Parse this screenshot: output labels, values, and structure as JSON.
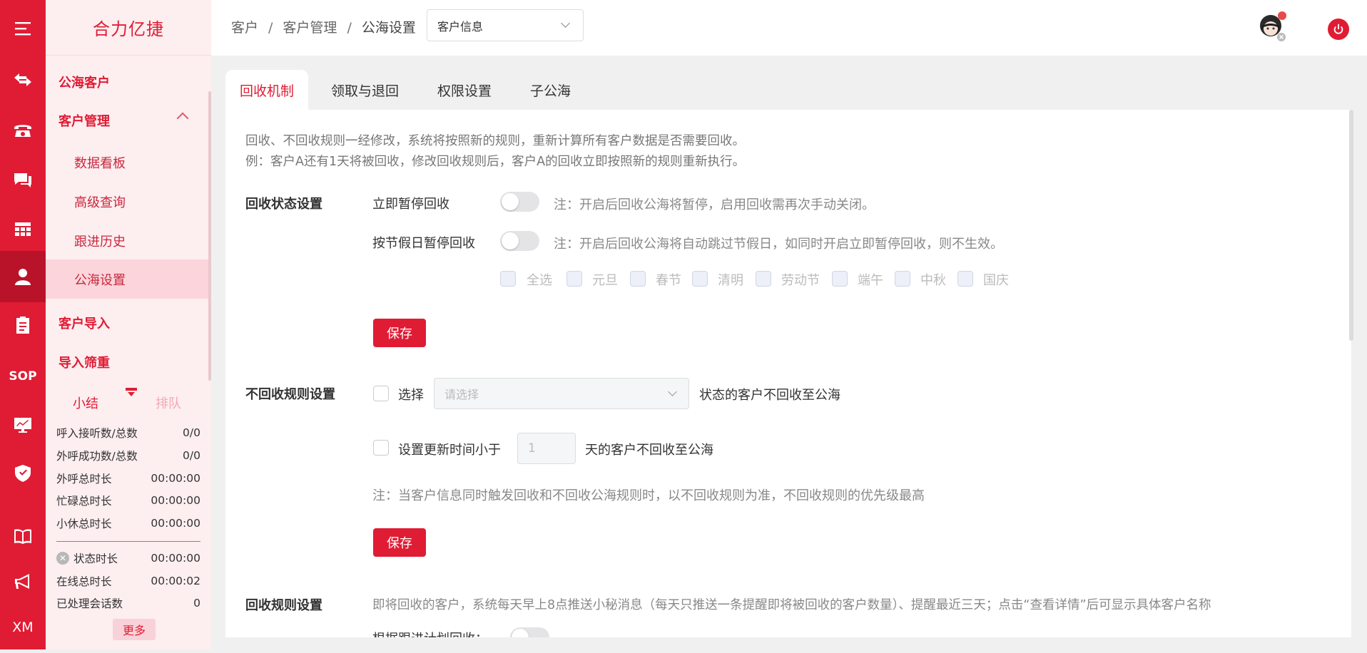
{
  "app": {
    "brand": "合力亿捷"
  },
  "rail": {
    "sop_label": "SOP",
    "xm_label": "XM"
  },
  "sidebar": {
    "group_public": "公海客户",
    "group_manage": "客户管理",
    "sub_dashboard": "数据看板",
    "sub_query": "高级查询",
    "sub_history": "跟进历史",
    "sub_settings": "公海设置",
    "group_import": "客户导入",
    "group_dedupe": "导入筛重"
  },
  "stats": {
    "tab_summary": "小结",
    "tab_queue": "排队",
    "rows": [
      {
        "label": "呼入接听数/总数",
        "value": "0/0"
      },
      {
        "label": "外呼成功数/总数",
        "value": "0/0"
      },
      {
        "label": "外呼总时长",
        "value": "00:00:00"
      },
      {
        "label": "忙碌总时长",
        "value": "00:00:00"
      },
      {
        "label": "小休总时长",
        "value": "00:00:00"
      }
    ],
    "state_label": "状态时长",
    "state_value": "00:00:00",
    "online_label": "在线总时长",
    "online_value": "00:00:02",
    "handled_label": "已处理会话数",
    "handled_value": "0",
    "more": "更多"
  },
  "header": {
    "crumb1": "客户",
    "crumb2": "客户管理",
    "crumb3": "公海设置",
    "sep": "/",
    "select_value": "客户信息"
  },
  "tabs": {
    "recycle": "回收机制",
    "claim": "领取与退回",
    "permission": "权限设置",
    "sub_sea": "子公海"
  },
  "intro": {
    "line1": "回收、不回收规则一经修改，系统将按照新的规则，重新计算所有客户数据是否需要回收。",
    "line2": "例：客户A还有1天将被回收，修改回收规则后，客户A的回收立即按照新的规则重新执行。"
  },
  "status_section": {
    "title": "回收状态设置",
    "pause_label": "立即暂停回收",
    "pause_hint": "注：开启后回收公海将暂停，启用回收需再次手动关闭。",
    "holiday_label": "按节假日暂停回收",
    "holiday_hint": "注：开启后回收公海将自动跳过节假日，如同时开启立即暂停回收，则不生效。",
    "holidays": [
      "全选",
      "元旦",
      "春节",
      "清明",
      "劳动节",
      "端午",
      "中秋",
      "国庆"
    ],
    "save": "保存"
  },
  "norecycle_section": {
    "title": "不回收规则设置",
    "choose_label": "选择",
    "select_placeholder": "请选择",
    "choose_suffix": "状态的客户不回收至公海",
    "update_label": "设置更新时间小于",
    "days_value": "1",
    "update_suffix": "天的客户不回收至公海",
    "note": "注：当客户信息同时触发回收和不回收公海规则时，以不回收规则为准，不回收规则的优先级最高",
    "save": "保存"
  },
  "rule_section": {
    "title": "回收规则设置",
    "desc": "即将回收的客户，系统每天早上8点推送小秘消息（每天只推送一条提醒即将被回收的客户数量）、提醒最近三天；点击“查看详情”后可显示具体客户名称",
    "plan_label": "根据跟进计划回收："
  },
  "colors": {
    "accent": "#e01c34",
    "sidebar_bg": "#fdeef0"
  }
}
